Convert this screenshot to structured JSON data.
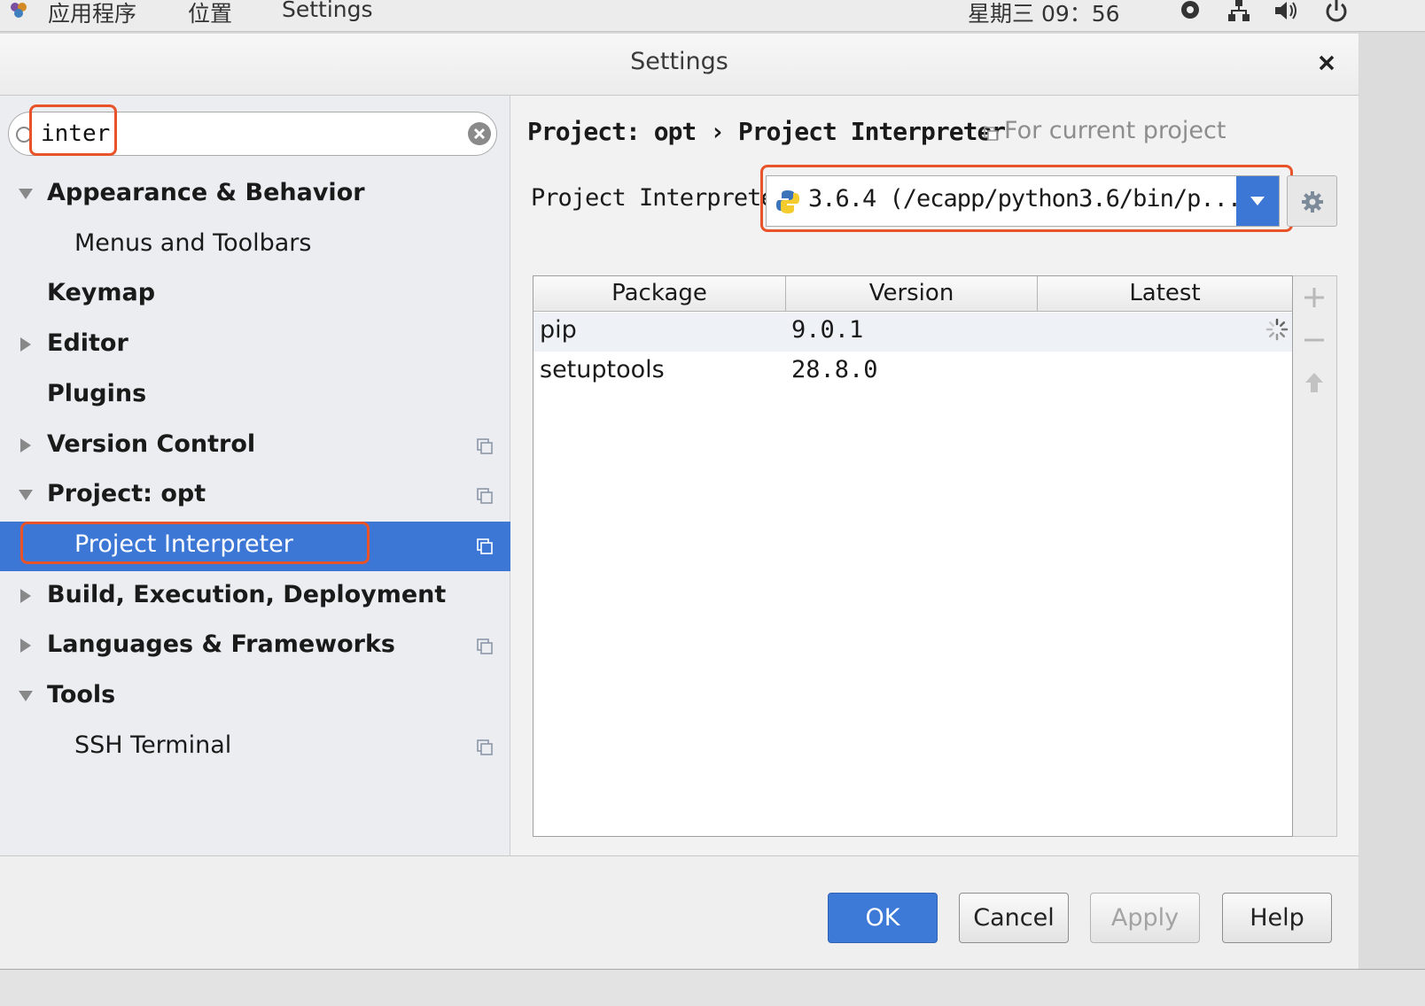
{
  "system_bar": {
    "menu_applications": "应用程序",
    "menu_places": "位置",
    "menu_settings": "Settings",
    "clock": "星期三 09：56"
  },
  "dialog": {
    "title": "Settings"
  },
  "search": {
    "value": "inter"
  },
  "tree": [
    {
      "label": "Appearance & Behavior",
      "bold": true,
      "arrow": "down"
    },
    {
      "label": "Menus and Toolbars",
      "bold": false,
      "arrow": "none"
    },
    {
      "label": "Keymap",
      "bold": true,
      "arrow": "none"
    },
    {
      "label": "Editor",
      "bold": true,
      "arrow": "right"
    },
    {
      "label": "Plugins",
      "bold": true,
      "arrow": "none"
    },
    {
      "label": "Version Control",
      "bold": true,
      "arrow": "right"
    },
    {
      "label": "Project: opt",
      "bold": true,
      "arrow": "down"
    },
    {
      "label": "Project Interpreter",
      "bold": false,
      "arrow": "none",
      "selected": true
    },
    {
      "label": "Build, Execution, Deployment",
      "bold": true,
      "arrow": "right"
    },
    {
      "label": "Languages & Frameworks",
      "bold": true,
      "arrow": "right"
    },
    {
      "label": "Tools",
      "bold": true,
      "arrow": "down"
    },
    {
      "label": "SSH Terminal",
      "bold": false,
      "arrow": "none"
    }
  ],
  "breadcrumb": {
    "text": "Project: opt › Project Interpreter",
    "hint": "For current project"
  },
  "interpreter": {
    "label": "Project Interpreter:",
    "value": "3.6.4 (/ecapp/python3.6/bin/p..."
  },
  "packages": {
    "columns": [
      "Package",
      "Version",
      "Latest"
    ],
    "rows": [
      {
        "package": "pip",
        "version": "9.0.1",
        "latest": ""
      },
      {
        "package": "setuptools",
        "version": "28.8.0",
        "latest": ""
      }
    ]
  },
  "buttons": {
    "ok": "OK",
    "cancel": "Cancel",
    "apply": "Apply",
    "help": "Help"
  },
  "colors": {
    "accent": "#3c77d6",
    "highlight": "#e9532a"
  }
}
